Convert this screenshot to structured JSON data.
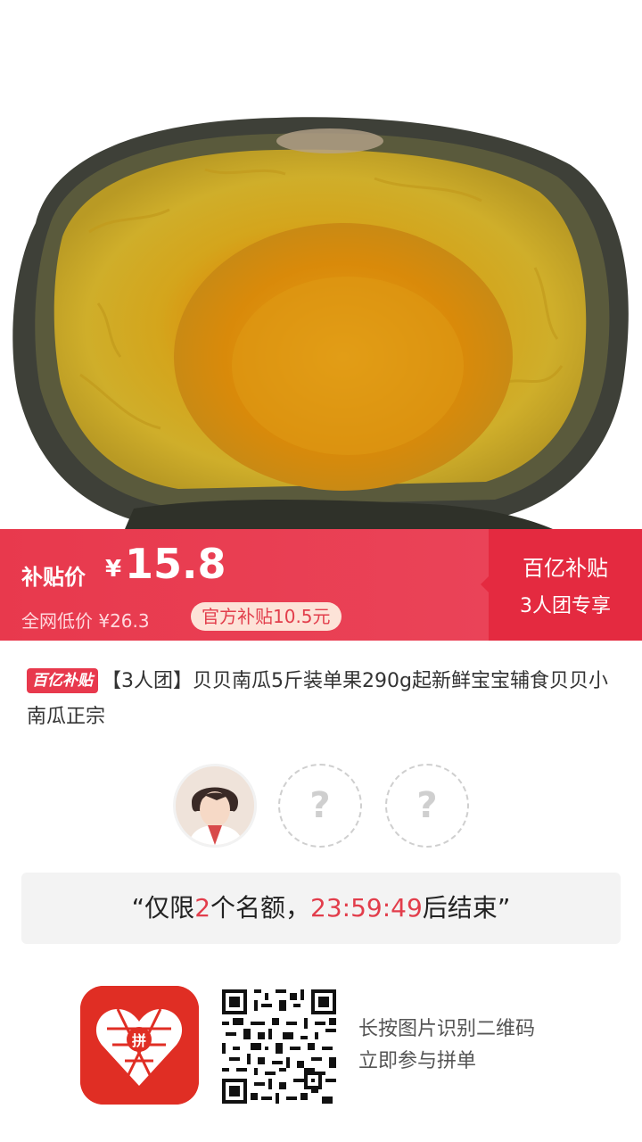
{
  "banner": {
    "subsidy_label": "补贴价",
    "currency": "¥",
    "subsidy_price": "15.8",
    "original_label": "全网低价 ¥26.3",
    "subsidy_tag": "官方补贴10.5元",
    "side_title": "百亿补贴",
    "side_subtitle": "3人团专享",
    "colors": {
      "banner_red": "#e8394d",
      "side_red": "#e42a40",
      "tag_bg": "#fde3d8"
    }
  },
  "product": {
    "badge": "百亿补贴",
    "title": "【3人团】贝贝南瓜5斤装单果290g起新鲜宝宝辅食贝贝小南瓜正宗",
    "image_icon": "pumpkin-image"
  },
  "group": {
    "slots": [
      {
        "type": "user",
        "icon": "user-avatar"
      },
      {
        "type": "empty",
        "mark": "?"
      },
      {
        "type": "empty",
        "mark": "?"
      }
    ]
  },
  "quota": {
    "open_quote": "“",
    "prefix": "仅限",
    "count": "2",
    "middle": "个名额，",
    "countdown": "23:59:49",
    "suffix": "后结束",
    "close_quote": "”"
  },
  "footer": {
    "app_icon": "pinduoduo-logo",
    "qr_icon": "qr-code",
    "hint_line1": "长按图片识别二维码",
    "hint_line2": "立即参与拼单"
  }
}
